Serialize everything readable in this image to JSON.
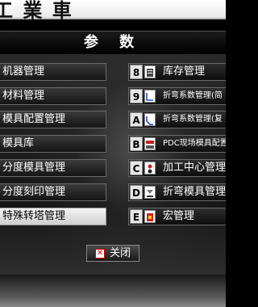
{
  "top_bar": {
    "title": "工 業 車"
  },
  "dialog": {
    "title": "参 数"
  },
  "left_buttons": [
    {
      "label": "机器管理"
    },
    {
      "label": "材料管理"
    },
    {
      "label": "模具配置管理"
    },
    {
      "label": "模具库"
    },
    {
      "label": "分度模具管理"
    },
    {
      "label": "分度刻印管理"
    },
    {
      "label": "特殊转塔管理"
    }
  ],
  "right_buttons": [
    {
      "key": "8",
      "label": "库存管理",
      "icon": "inventory-icon"
    },
    {
      "key": "9",
      "label": "折弯系数管理(简",
      "icon": "bend-simple-icon"
    },
    {
      "key": "A",
      "label": "折弯系数管理(复",
      "icon": "bend-complex-icon"
    },
    {
      "key": "B",
      "label": "PDC现场模具配置",
      "icon": "pdc-icon"
    },
    {
      "key": "C",
      "label": "加工中心管理",
      "icon": "machining-center-icon"
    },
    {
      "key": "D",
      "label": "折弯模具管理",
      "icon": "bend-die-icon"
    },
    {
      "key": "E",
      "label": "宏管理",
      "icon": "macro-icon"
    }
  ],
  "selected_left_index": 6,
  "close_button": {
    "label": "关闭",
    "icon": "close-icon"
  },
  "colors": {
    "button_bg": "#1f1f1f",
    "selected_bg": "#e8e8e8",
    "close_x": "#cc0000"
  }
}
